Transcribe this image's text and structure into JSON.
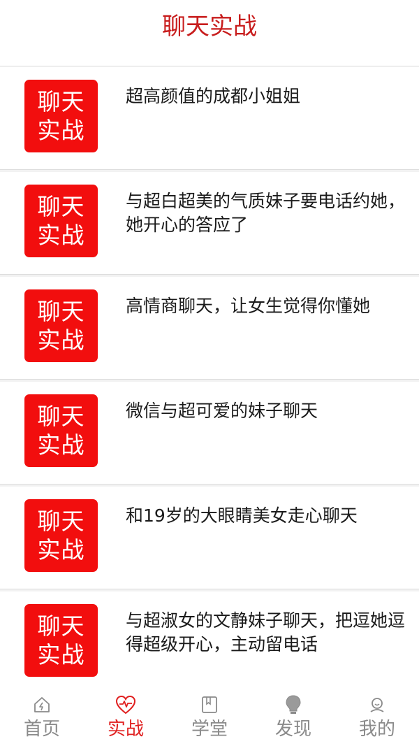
{
  "header": {
    "title": "聊天实战"
  },
  "items": [
    {
      "badge_line1": "聊天",
      "badge_line2": "实战",
      "title": "超高颜值的成都小姐姐"
    },
    {
      "badge_line1": "聊天",
      "badge_line2": "实战",
      "title": "与超白超美的气质妹子要电话约她，她开心的答应了"
    },
    {
      "badge_line1": "聊天",
      "badge_line2": "实战",
      "title": "高情商聊天，让女生觉得你懂她"
    },
    {
      "badge_line1": "聊天",
      "badge_line2": "实战",
      "title": "微信与超可爱的妹子聊天"
    },
    {
      "badge_line1": "聊天",
      "badge_line2": "实战",
      "title": "和19岁的大眼睛美女走心聊天"
    },
    {
      "badge_line1": "聊天",
      "badge_line2": "实战",
      "title": "与超淑女的文静妹子聊天，把逗她逗得超级开心，主动留电话"
    }
  ],
  "tabbar": {
    "tabs": [
      {
        "label": "首页",
        "icon": "home-icon",
        "active": false
      },
      {
        "label": "实战",
        "icon": "heartbeat-icon",
        "active": true
      },
      {
        "label": "学堂",
        "icon": "book-icon",
        "active": false
      },
      {
        "label": "发现",
        "icon": "lightbulb-icon",
        "active": false
      },
      {
        "label": "我的",
        "icon": "profile-icon",
        "active": false
      }
    ],
    "active_color": "#e02020",
    "inactive_color": "#8a8a8a"
  },
  "colors": {
    "accent": "#c81d1d",
    "badge": "#f20e0e"
  }
}
